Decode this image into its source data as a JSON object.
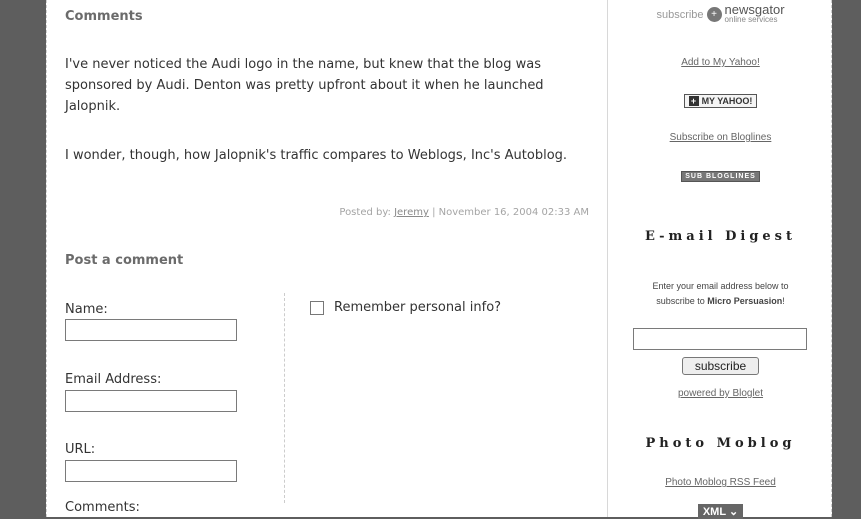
{
  "comments": {
    "heading": "Comments",
    "paragraphs": [
      "I've never noticed the Audi logo in the name, but knew that the blog was sponsored by Audi. Denton was pretty upfront about it when he launched Jalopnik.",
      "I wonder, though, how Jalopnik's traffic compares to Weblogs, Inc's Autoblog."
    ],
    "posted_prefix": "Posted by: ",
    "author": "Jeremy",
    "posted_date": " | November 16, 2004 02:33 AM"
  },
  "form": {
    "heading": "Post a comment",
    "name_label": "Name:",
    "email_label": "Email Address:",
    "url_label": "URL:",
    "comments_label": "Comments:",
    "remember_label": "Remember personal info?"
  },
  "sidebar": {
    "subscribe_label": "subscribe",
    "newsgator_brand": "newsgator",
    "newsgator_sub": "online services",
    "add_yahoo": "Add to My Yahoo!",
    "yahoo_button": "MY YAHOO!",
    "subscribe_bloglines": "Subscribe on Bloglines",
    "bloglines_button": "SUB BLOGLINES",
    "email_heading": "E-mail Digest",
    "email_desc_1": "Enter your email address below to",
    "email_desc_2": "subscribe to ",
    "email_desc_bold": "Micro Persuasion",
    "email_desc_end": "!",
    "subscribe_button": "subscribe",
    "powered_by": "powered by Bloglet",
    "moblog_heading": "Photo Moblog",
    "moblog_feed": "Photo Moblog RSS Feed",
    "xml_badge": "XML"
  }
}
